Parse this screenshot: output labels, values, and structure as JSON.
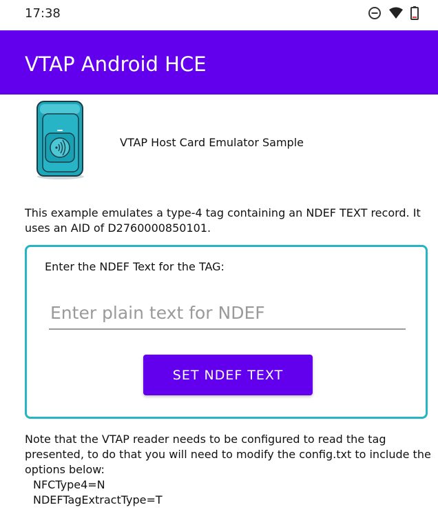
{
  "status_bar": {
    "time": "17:38",
    "icons": [
      "do-not-disturb-icon",
      "wifi-icon",
      "battery-icon"
    ]
  },
  "app_bar": {
    "title": "VTAP Android HCE",
    "color": "#6200ee"
  },
  "header": {
    "image_icon": "vtap-reader-device-icon",
    "sample_title": "VTAP Host Card Emulator Sample"
  },
  "description": "This example emulates a type-4 tag containing an NDEF TEXT record. It uses an AID of D2760000850101.",
  "ndef_form": {
    "label": "Enter the NDEF Text for the TAG:",
    "input_value": "",
    "input_placeholder": "Enter plain text for NDEF",
    "button_label": "SET NDEF TEXT",
    "border_color": "#26b4c6"
  },
  "note": {
    "text": "Note that the VTAP reader needs to be configured to read the tag presented, to do that you will need to modify the config.txt to include the options below:",
    "options": [
      "NFCType4=N",
      "NDEFTagExtractType=T"
    ]
  }
}
